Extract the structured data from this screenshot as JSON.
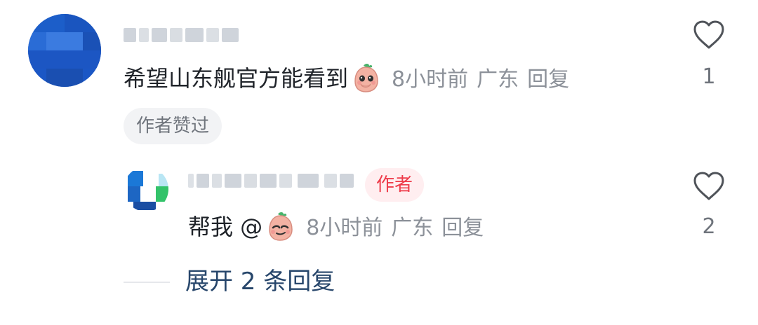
{
  "comment": {
    "text": "希望山东舰官方能看到",
    "emoji_icon": "peach-covering-mouth-emoji",
    "time": "8小时前",
    "location": "广东",
    "reply_label": "回复",
    "chip_label": "作者赞过",
    "likes": "1"
  },
  "reply": {
    "text": "帮我 @",
    "emoji_icon": "peach-smug-emoji",
    "time": "8小时前",
    "location": "广东",
    "reply_label": "回复",
    "author_badge": "作者",
    "likes": "2"
  },
  "expand": {
    "label": "展开 2 条回复"
  },
  "colors": {
    "text": "#1f2329",
    "meta": "#8c9199",
    "chip_bg": "#f2f3f5",
    "author_badge_bg": "#ffeef0",
    "author_badge_text": "#ee3b4a",
    "expand_link": "#27466b",
    "heart_stroke": "#4f5359"
  }
}
